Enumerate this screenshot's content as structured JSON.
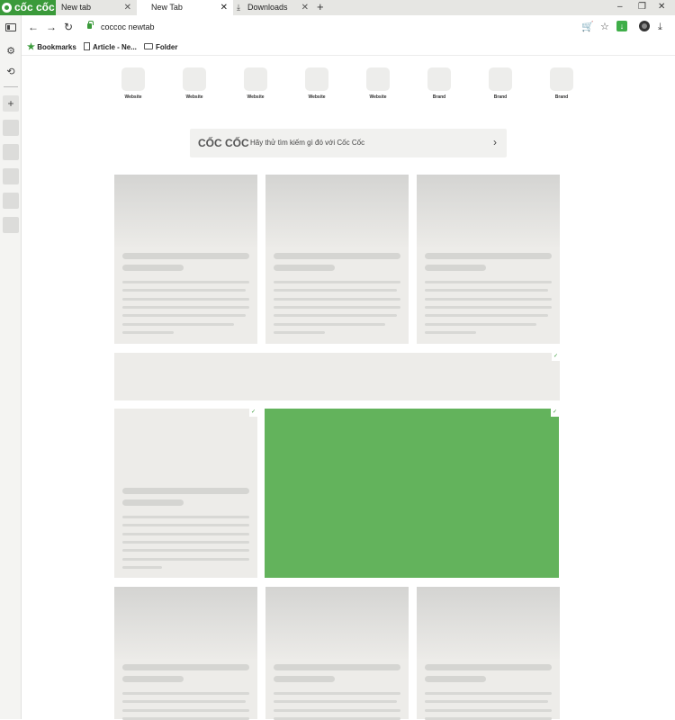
{
  "tabs": {
    "brand": "cốc cốc",
    "items": [
      {
        "label": "New tab"
      },
      {
        "label": "New Tab"
      },
      {
        "label": "Downloads"
      }
    ]
  },
  "toolbar": {
    "url": "coccoc newtab"
  },
  "bookmarks": {
    "items": [
      {
        "label": "Bookmarks"
      },
      {
        "label": "Article - Ne..."
      },
      {
        "label": "Folder"
      }
    ]
  },
  "shortcuts": [
    {
      "label": "Website"
    },
    {
      "label": "Website"
    },
    {
      "label": "Website"
    },
    {
      "label": "Website"
    },
    {
      "label": "Website"
    },
    {
      "label": "Brand"
    },
    {
      "label": "Brand"
    },
    {
      "label": "Brand"
    }
  ],
  "search": {
    "logo": "CỐC CỐC",
    "hint": "Hãy thử tìm kiếm gì đó với Cốc Cốc"
  },
  "icons": {
    "tab_close": "close-icon",
    "downloads": "download-icon",
    "new_tab": "plus-icon",
    "back": "back-arrow-icon",
    "forward": "forward-arrow-icon",
    "reload": "reload-icon",
    "cart": "cart-icon",
    "star": "star-icon"
  },
  "colors": {
    "brand_green": "#3a9a3a",
    "promo_green": "#63b35c"
  }
}
